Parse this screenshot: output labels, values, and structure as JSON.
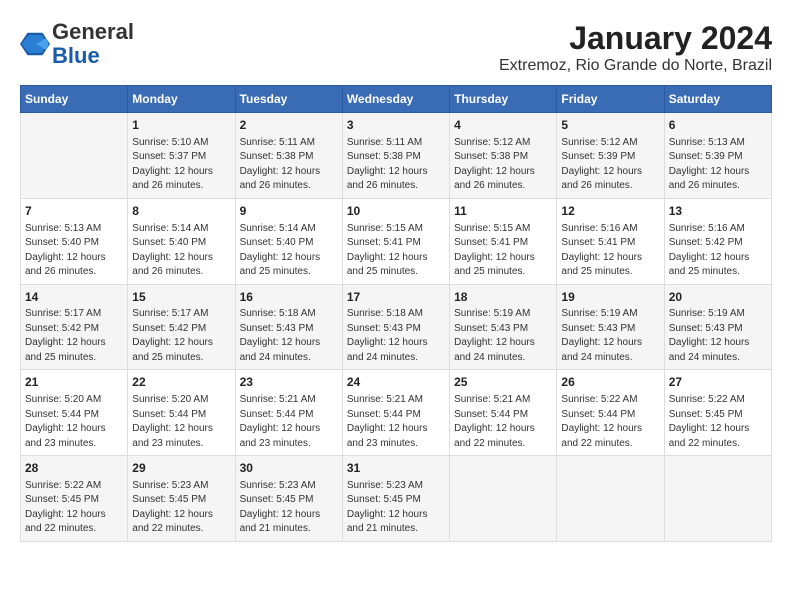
{
  "header": {
    "logo_line1": "General",
    "logo_line2": "Blue",
    "title": "January 2024",
    "subtitle": "Extremoz, Rio Grande do Norte, Brazil"
  },
  "days_of_week": [
    "Sunday",
    "Monday",
    "Tuesday",
    "Wednesday",
    "Thursday",
    "Friday",
    "Saturday"
  ],
  "weeks": [
    [
      {
        "day": "",
        "info": ""
      },
      {
        "day": "1",
        "info": "Sunrise: 5:10 AM\nSunset: 5:37 PM\nDaylight: 12 hours\nand 26 minutes."
      },
      {
        "day": "2",
        "info": "Sunrise: 5:11 AM\nSunset: 5:38 PM\nDaylight: 12 hours\nand 26 minutes."
      },
      {
        "day": "3",
        "info": "Sunrise: 5:11 AM\nSunset: 5:38 PM\nDaylight: 12 hours\nand 26 minutes."
      },
      {
        "day": "4",
        "info": "Sunrise: 5:12 AM\nSunset: 5:38 PM\nDaylight: 12 hours\nand 26 minutes."
      },
      {
        "day": "5",
        "info": "Sunrise: 5:12 AM\nSunset: 5:39 PM\nDaylight: 12 hours\nand 26 minutes."
      },
      {
        "day": "6",
        "info": "Sunrise: 5:13 AM\nSunset: 5:39 PM\nDaylight: 12 hours\nand 26 minutes."
      }
    ],
    [
      {
        "day": "7",
        "info": "Sunrise: 5:13 AM\nSunset: 5:40 PM\nDaylight: 12 hours\nand 26 minutes."
      },
      {
        "day": "8",
        "info": "Sunrise: 5:14 AM\nSunset: 5:40 PM\nDaylight: 12 hours\nand 26 minutes."
      },
      {
        "day": "9",
        "info": "Sunrise: 5:14 AM\nSunset: 5:40 PM\nDaylight: 12 hours\nand 25 minutes."
      },
      {
        "day": "10",
        "info": "Sunrise: 5:15 AM\nSunset: 5:41 PM\nDaylight: 12 hours\nand 25 minutes."
      },
      {
        "day": "11",
        "info": "Sunrise: 5:15 AM\nSunset: 5:41 PM\nDaylight: 12 hours\nand 25 minutes."
      },
      {
        "day": "12",
        "info": "Sunrise: 5:16 AM\nSunset: 5:41 PM\nDaylight: 12 hours\nand 25 minutes."
      },
      {
        "day": "13",
        "info": "Sunrise: 5:16 AM\nSunset: 5:42 PM\nDaylight: 12 hours\nand 25 minutes."
      }
    ],
    [
      {
        "day": "14",
        "info": "Sunrise: 5:17 AM\nSunset: 5:42 PM\nDaylight: 12 hours\nand 25 minutes."
      },
      {
        "day": "15",
        "info": "Sunrise: 5:17 AM\nSunset: 5:42 PM\nDaylight: 12 hours\nand 25 minutes."
      },
      {
        "day": "16",
        "info": "Sunrise: 5:18 AM\nSunset: 5:43 PM\nDaylight: 12 hours\nand 24 minutes."
      },
      {
        "day": "17",
        "info": "Sunrise: 5:18 AM\nSunset: 5:43 PM\nDaylight: 12 hours\nand 24 minutes."
      },
      {
        "day": "18",
        "info": "Sunrise: 5:19 AM\nSunset: 5:43 PM\nDaylight: 12 hours\nand 24 minutes."
      },
      {
        "day": "19",
        "info": "Sunrise: 5:19 AM\nSunset: 5:43 PM\nDaylight: 12 hours\nand 24 minutes."
      },
      {
        "day": "20",
        "info": "Sunrise: 5:19 AM\nSunset: 5:43 PM\nDaylight: 12 hours\nand 24 minutes."
      }
    ],
    [
      {
        "day": "21",
        "info": "Sunrise: 5:20 AM\nSunset: 5:44 PM\nDaylight: 12 hours\nand 23 minutes."
      },
      {
        "day": "22",
        "info": "Sunrise: 5:20 AM\nSunset: 5:44 PM\nDaylight: 12 hours\nand 23 minutes."
      },
      {
        "day": "23",
        "info": "Sunrise: 5:21 AM\nSunset: 5:44 PM\nDaylight: 12 hours\nand 23 minutes."
      },
      {
        "day": "24",
        "info": "Sunrise: 5:21 AM\nSunset: 5:44 PM\nDaylight: 12 hours\nand 23 minutes."
      },
      {
        "day": "25",
        "info": "Sunrise: 5:21 AM\nSunset: 5:44 PM\nDaylight: 12 hours\nand 22 minutes."
      },
      {
        "day": "26",
        "info": "Sunrise: 5:22 AM\nSunset: 5:44 PM\nDaylight: 12 hours\nand 22 minutes."
      },
      {
        "day": "27",
        "info": "Sunrise: 5:22 AM\nSunset: 5:45 PM\nDaylight: 12 hours\nand 22 minutes."
      }
    ],
    [
      {
        "day": "28",
        "info": "Sunrise: 5:22 AM\nSunset: 5:45 PM\nDaylight: 12 hours\nand 22 minutes."
      },
      {
        "day": "29",
        "info": "Sunrise: 5:23 AM\nSunset: 5:45 PM\nDaylight: 12 hours\nand 22 minutes."
      },
      {
        "day": "30",
        "info": "Sunrise: 5:23 AM\nSunset: 5:45 PM\nDaylight: 12 hours\nand 21 minutes."
      },
      {
        "day": "31",
        "info": "Sunrise: 5:23 AM\nSunset: 5:45 PM\nDaylight: 12 hours\nand 21 minutes."
      },
      {
        "day": "",
        "info": ""
      },
      {
        "day": "",
        "info": ""
      },
      {
        "day": "",
        "info": ""
      }
    ]
  ]
}
